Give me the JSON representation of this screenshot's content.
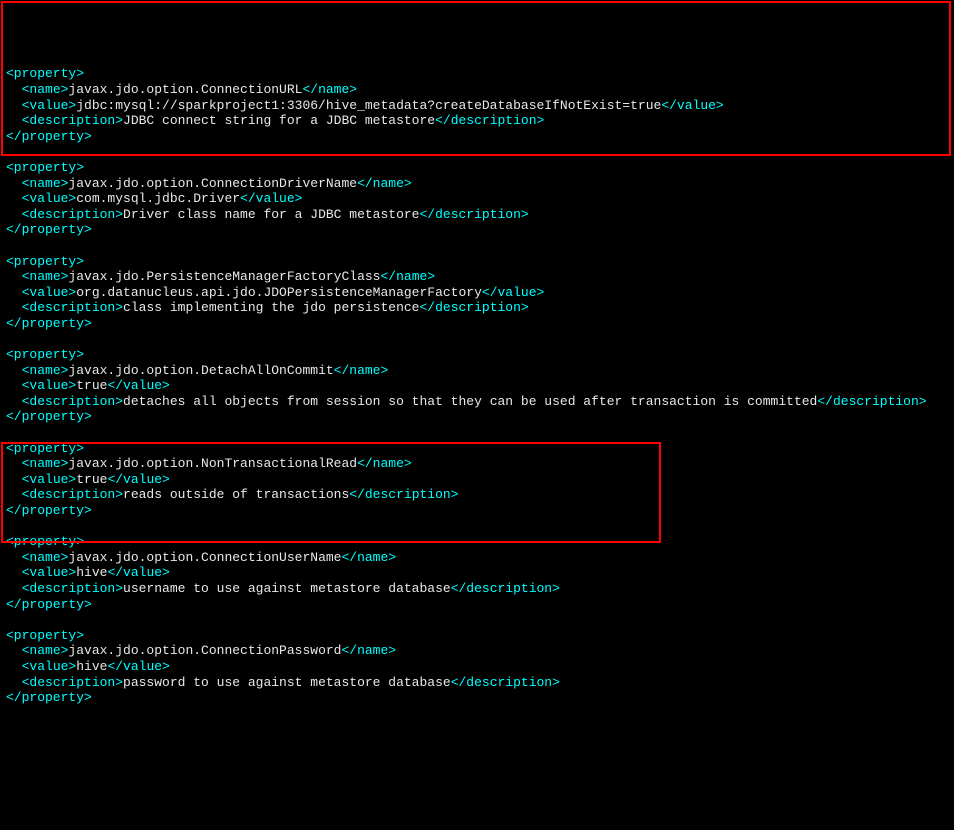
{
  "properties": [
    {
      "name": "javax.jdo.option.ConnectionURL",
      "value": "jdbc:mysql://sparkproject1:3306/hive_metadata?createDatabaseIfNotExist=true",
      "description": "JDBC connect string for a JDBC metastore",
      "indent": true
    },
    {
      "name": "javax.jdo.option.ConnectionDriverName",
      "value": "com.mysql.jdbc.Driver",
      "description": "Driver class name for a JDBC metastore",
      "indent": true
    },
    {
      "name": "javax.jdo.PersistenceManagerFactoryClass",
      "value": "org.datanucleus.api.jdo.JDOPersistenceManagerFactory",
      "description": "class implementing the jdo persistence",
      "indent": true
    },
    {
      "name": "javax.jdo.option.DetachAllOnCommit",
      "value": "true",
      "description": "detaches all objects from session so that they can be used after transaction is committed",
      "indent": true
    },
    {
      "name": "javax.jdo.option.NonTransactionalRead",
      "value": "true",
      "description": "reads outside of transactions",
      "indent": true
    },
    {
      "name": "javax.jdo.option.ConnectionUserName",
      "value": "hive",
      "description": "username to use against metastore database",
      "indent": true
    },
    {
      "name": "javax.jdo.option.ConnectionPassword",
      "value": "hive",
      "description": "password to use against metastore database",
      "indent": true
    }
  ],
  "tags": {
    "propOpen": "<property>",
    "propClose": "</property>",
    "nameOpen": "<name>",
    "nameClose": "</name>",
    "valueOpen": "<value>",
    "valueClose": "</value>",
    "descOpen": "<description>",
    "descClose": "</description>"
  }
}
